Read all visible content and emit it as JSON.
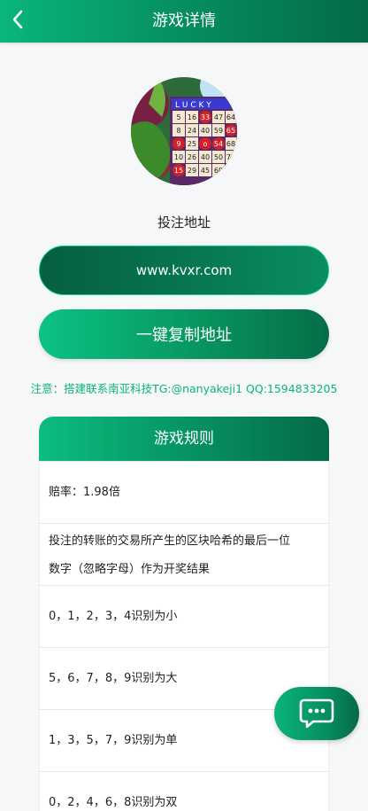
{
  "header": {
    "title": "游戏详情",
    "back_icon": "chevron-left-icon"
  },
  "game": {
    "image_alt": "bingo-game-image",
    "address_label": "投注地址",
    "address_value": "www.kvxr.com",
    "copy_button_label": "一键复制地址",
    "notice": "注意：搭建联系南亚科技TG:@nanyakeji1 QQ:1594833205"
  },
  "rules": {
    "title": "游戏规则",
    "items": [
      "赔率：1.98倍",
      "投注的转账的交易所产生的区块哈希的最后一位",
      "数字（忽略字母）作为开奖结果",
      "0，1，2，3，4识别为小",
      "5，6，7，8，9识别为大",
      "1，3，5，7，9识别为单",
      "0，2，4，6，8识别为双"
    ]
  },
  "chat": {
    "icon": "chat-bubble-icon"
  },
  "colors": {
    "accent": "#07965f",
    "accent_light": "#0bbd7f",
    "notice_text": "#0db37a",
    "background": "#f6f7f9"
  }
}
